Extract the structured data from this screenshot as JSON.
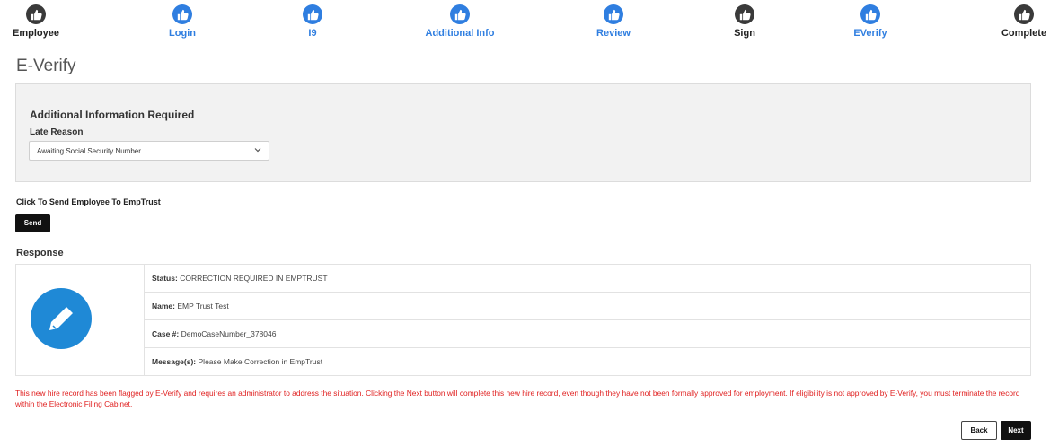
{
  "stepper": {
    "steps": [
      {
        "label": "Employee",
        "state": "inactive"
      },
      {
        "label": "Login",
        "state": "active"
      },
      {
        "label": "I9",
        "state": "active"
      },
      {
        "label": "Additional Info",
        "state": "active"
      },
      {
        "label": "Review",
        "state": "active"
      },
      {
        "label": "Sign",
        "state": "inactive"
      },
      {
        "label": "EVerify",
        "state": "active"
      },
      {
        "label": "Complete",
        "state": "inactive"
      }
    ],
    "icon": "thumbs-up-icon",
    "colors": {
      "active": "#2f7ee0",
      "inactive": "#3a3a3a"
    }
  },
  "page": {
    "title": "E-Verify"
  },
  "additional_info": {
    "heading": "Additional Information Required",
    "late_reason_label": "Late Reason",
    "late_reason_value": "Awaiting Social Security Number"
  },
  "send": {
    "heading": "Click To Send Employee To EmpTrust",
    "button_label": "Send"
  },
  "response": {
    "heading": "Response",
    "icon": "pencil-icon",
    "status_label": "Status:",
    "status_value": "CORRECTION REQUIRED IN EMPTRUST",
    "name_label": "Name:",
    "name_value": "EMP Trust Test",
    "case_label": "Case #:",
    "case_value": "DemoCaseNumber_378046",
    "message_label": "Message(s):",
    "message_value": "Please Make Correction in EmpTrust"
  },
  "warning": "This new hire record has been flagged by E-Verify and requires an administrator to address the situation. Clicking the Next button will complete this new hire record, even though they have not been formally approved for employment. If eligibility is not approved by E-Verify, you must terminate the record within the Electronic Filing Cabinet.",
  "nav": {
    "back_label": "Back",
    "next_label": "Next"
  },
  "colors": {
    "warning": "#e02020",
    "accent": "#1f89d6"
  }
}
